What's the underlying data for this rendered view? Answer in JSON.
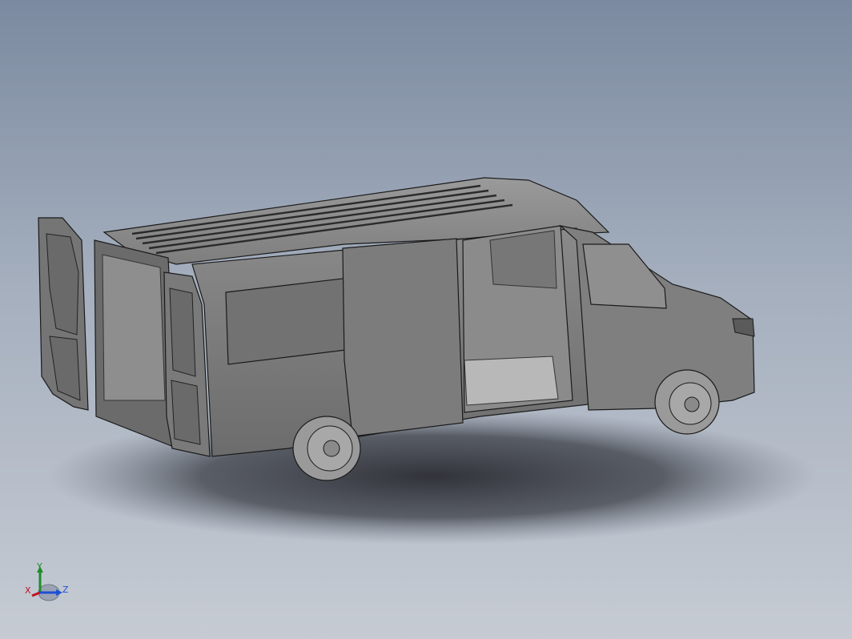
{
  "viewport": {
    "background_top": "#7b8aa0",
    "background_bottom": "#c6cbd3",
    "model_body_color": "#7d7d7d",
    "model_shadow_color": "#2a2c32",
    "edge_color": "#1a1a1a"
  },
  "model": {
    "icon": "van-3d-model"
  },
  "triad": {
    "x_label": "X",
    "y_label": "Y",
    "z_label": "Z",
    "x_color": "#c1121f",
    "y_color": "#1f8c2a",
    "z_color": "#1d4fd6"
  }
}
